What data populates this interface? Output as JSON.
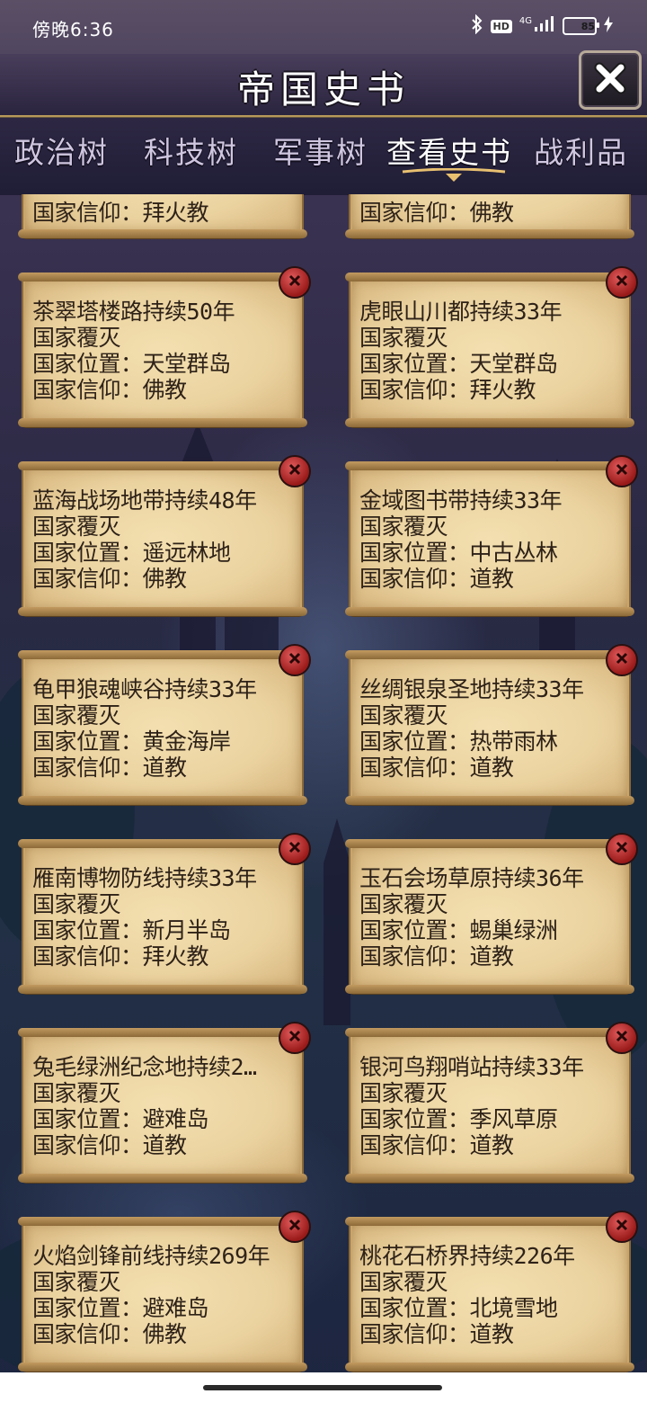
{
  "status_bar": {
    "time": "傍晚6:36",
    "hd": "HD",
    "network": "4G",
    "battery": "85"
  },
  "header": {
    "title": "帝国史书"
  },
  "tabs": [
    {
      "label": "政治树",
      "active": false
    },
    {
      "label": "科技树",
      "active": false
    },
    {
      "label": "军事树",
      "active": false
    },
    {
      "label": "查看史书",
      "active": true
    },
    {
      "label": "战利品",
      "active": false
    }
  ],
  "records": [
    {
      "lines": [
        "国家信仰：拜火教"
      ]
    },
    {
      "lines": [
        "国家信仰：佛教"
      ]
    },
    {
      "lines": [
        "茶翠塔楼路持续50年",
        "国家覆灭",
        "国家位置：天堂群岛",
        "国家信仰：佛教"
      ]
    },
    {
      "lines": [
        "虎眼山川都持续33年",
        "国家覆灭",
        "国家位置：天堂群岛",
        "国家信仰：拜火教"
      ]
    },
    {
      "lines": [
        "蓝海战场地带持续48年",
        "国家覆灭",
        "国家位置：遥远林地",
        "国家信仰：佛教"
      ]
    },
    {
      "lines": [
        "金域图书带持续33年",
        "国家覆灭",
        "国家位置：中古丛林",
        "国家信仰：道教"
      ]
    },
    {
      "lines": [
        "龟甲狼魂峡谷持续33年",
        "国家覆灭",
        "国家位置：黄金海岸",
        "国家信仰：道教"
      ]
    },
    {
      "lines": [
        "丝绸银泉圣地持续33年",
        "国家覆灭",
        "国家位置：热带雨林",
        "国家信仰：道教"
      ]
    },
    {
      "lines": [
        "雁南博物防线持续33年",
        "国家覆灭",
        "国家位置：新月半岛",
        "国家信仰：拜火教"
      ]
    },
    {
      "lines": [
        "玉石会场草原持续36年",
        "国家覆灭",
        "国家位置：蜴巢绿洲",
        "国家信仰：道教"
      ]
    },
    {
      "lines": [
        "兔毛绿洲纪念地持续2…",
        "国家覆灭",
        "国家位置：避难岛",
        "国家信仰：道教"
      ]
    },
    {
      "lines": [
        "银河鸟翔哨站持续33年",
        "国家覆灭",
        "国家位置：季风草原",
        "国家信仰：道教"
      ]
    },
    {
      "lines": [
        "火焰剑锋前线持续269年",
        "国家覆灭",
        "国家位置：避难岛",
        "国家信仰：佛教"
      ]
    },
    {
      "lines": [
        "桃花石桥界持续226年",
        "国家覆灭",
        "国家位置：北境雪地",
        "国家信仰：道教"
      ]
    }
  ]
}
